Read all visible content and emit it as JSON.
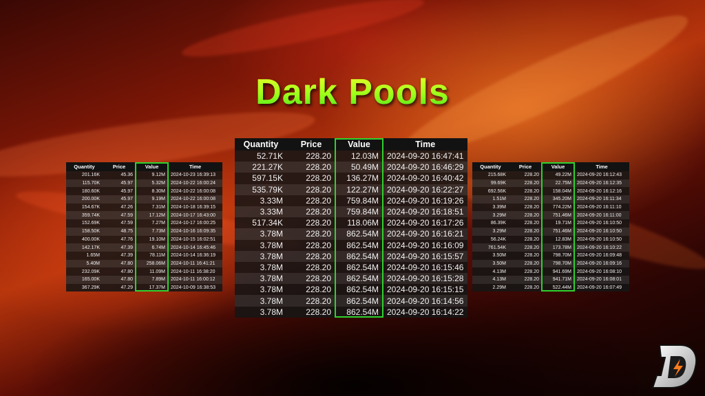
{
  "title": "Dark Pools",
  "colors": {
    "highlight": "#2fd12f",
    "title_top": "#f4ff2a",
    "title_bottom": "#3fe01a"
  },
  "logo": {
    "icon": "lightning-d-logo"
  },
  "headers": [
    "Quantity",
    "Price",
    "Value",
    "Time"
  ],
  "table_left": {
    "rows": [
      [
        "201.16K",
        "45.36",
        "9.12M",
        "2024-10-23 16:39:13"
      ],
      [
        "115.70K",
        "45.97",
        "5.32M",
        "2024-10-22 16:00:24"
      ],
      [
        "180.60K",
        "45.97",
        "8.30M",
        "2024-10-22 16:00:08"
      ],
      [
        "200.00K",
        "45.97",
        "9.19M",
        "2024-10-22 16:00:08"
      ],
      [
        "154.67K",
        "47.26",
        "7.31M",
        "2024-10-18 16:39:15"
      ],
      [
        "359.74K",
        "47.59",
        "17.12M",
        "2024-10-17 16:43:00"
      ],
      [
        "152.69K",
        "47.59",
        "7.27M",
        "2024-10-17 16:00:25"
      ],
      [
        "158.50K",
        "48.75",
        "7.73M",
        "2024-10-16 16:09:35"
      ],
      [
        "400.00K",
        "47.76",
        "19.10M",
        "2024-10-15 16:02:51"
      ],
      [
        "142.17K",
        "47.39",
        "6.74M",
        "2024-10-14 16:45:46"
      ],
      [
        "1.65M",
        "47.39",
        "78.11M",
        "2024-10-14 16:36:19"
      ],
      [
        "5.40M",
        "47.80",
        "258.06M",
        "2024-10-11 16:41:21"
      ],
      [
        "232.09K",
        "47.80",
        "11.09M",
        "2024-10-11 16:38:20"
      ],
      [
        "165.00K",
        "47.80",
        "7.89M",
        "2024-10-11 16:00:12"
      ],
      [
        "367.29K",
        "47.29",
        "17.37M",
        "2024-10-09 16:38:53"
      ]
    ]
  },
  "table_center": {
    "rows": [
      [
        "52.71K",
        "228.20",
        "12.03M",
        "2024-09-20 16:47:41"
      ],
      [
        "221.27K",
        "228.20",
        "50.49M",
        "2024-09-20 16:46:29"
      ],
      [
        "597.15K",
        "228.20",
        "136.27M",
        "2024-09-20 16:40:42"
      ],
      [
        "535.79K",
        "228.20",
        "122.27M",
        "2024-09-20 16:22:27"
      ],
      [
        "3.33M",
        "228.20",
        "759.84M",
        "2024-09-20 16:19:26"
      ],
      [
        "3.33M",
        "228.20",
        "759.84M",
        "2024-09-20 16:18:51"
      ],
      [
        "517.34K",
        "228.20",
        "118.06M",
        "2024-09-20 16:17:26"
      ],
      [
        "3.78M",
        "228.20",
        "862.54M",
        "2024-09-20 16:16:21"
      ],
      [
        "3.78M",
        "228.20",
        "862.54M",
        "2024-09-20 16:16:09"
      ],
      [
        "3.78M",
        "228.20",
        "862.54M",
        "2024-09-20 16:15:57"
      ],
      [
        "3.78M",
        "228.20",
        "862.54M",
        "2024-09-20 16:15:46"
      ],
      [
        "3.78M",
        "228.20",
        "862.54M",
        "2024-09-20 16:15:28"
      ],
      [
        "3.78M",
        "228.20",
        "862.54M",
        "2024-09-20 16:15:15"
      ],
      [
        "3.78M",
        "228.20",
        "862.54M",
        "2024-09-20 16:14:56"
      ],
      [
        "3.78M",
        "228.20",
        "862.54M",
        "2024-09-20 16:14:22"
      ]
    ]
  },
  "table_right": {
    "rows": [
      [
        "215.68K",
        "228.20",
        "49.22M",
        "2024-09-20 16:12:43"
      ],
      [
        "99.69K",
        "228.20",
        "22.75M",
        "2024-09-20 16:12:35"
      ],
      [
        "692.56K",
        "228.20",
        "158.04M",
        "2024-09-20 16:12:16"
      ],
      [
        "1.51M",
        "228.20",
        "345.20M",
        "2024-09-20 16:11:34"
      ],
      [
        "3.39M",
        "228.20",
        "774.22M",
        "2024-09-20 16:11:10"
      ],
      [
        "3.29M",
        "228.20",
        "751.46M",
        "2024-09-20 16:11:00"
      ],
      [
        "86.39K",
        "228.20",
        "19.71M",
        "2024-09-20 16:10:50"
      ],
      [
        "3.29M",
        "228.20",
        "751.46M",
        "2024-09-20 16:10:50"
      ],
      [
        "56.24K",
        "228.20",
        "12.83M",
        "2024-09-20 16:10:50"
      ],
      [
        "761.54K",
        "228.20",
        "173.78M",
        "2024-09-20 16:10:22"
      ],
      [
        "3.50M",
        "228.20",
        "798.70M",
        "2024-09-20 16:09:48"
      ],
      [
        "3.50M",
        "228.20",
        "798.70M",
        "2024-09-20 16:09:16"
      ],
      [
        "4.13M",
        "228.20",
        "941.69M",
        "2024-09-20 16:08:10"
      ],
      [
        "4.13M",
        "228.20",
        "941.71M",
        "2024-09-20 16:08:01"
      ],
      [
        "2.29M",
        "228.20",
        "522.44M",
        "2024-09-20 16:07:49"
      ]
    ]
  }
}
